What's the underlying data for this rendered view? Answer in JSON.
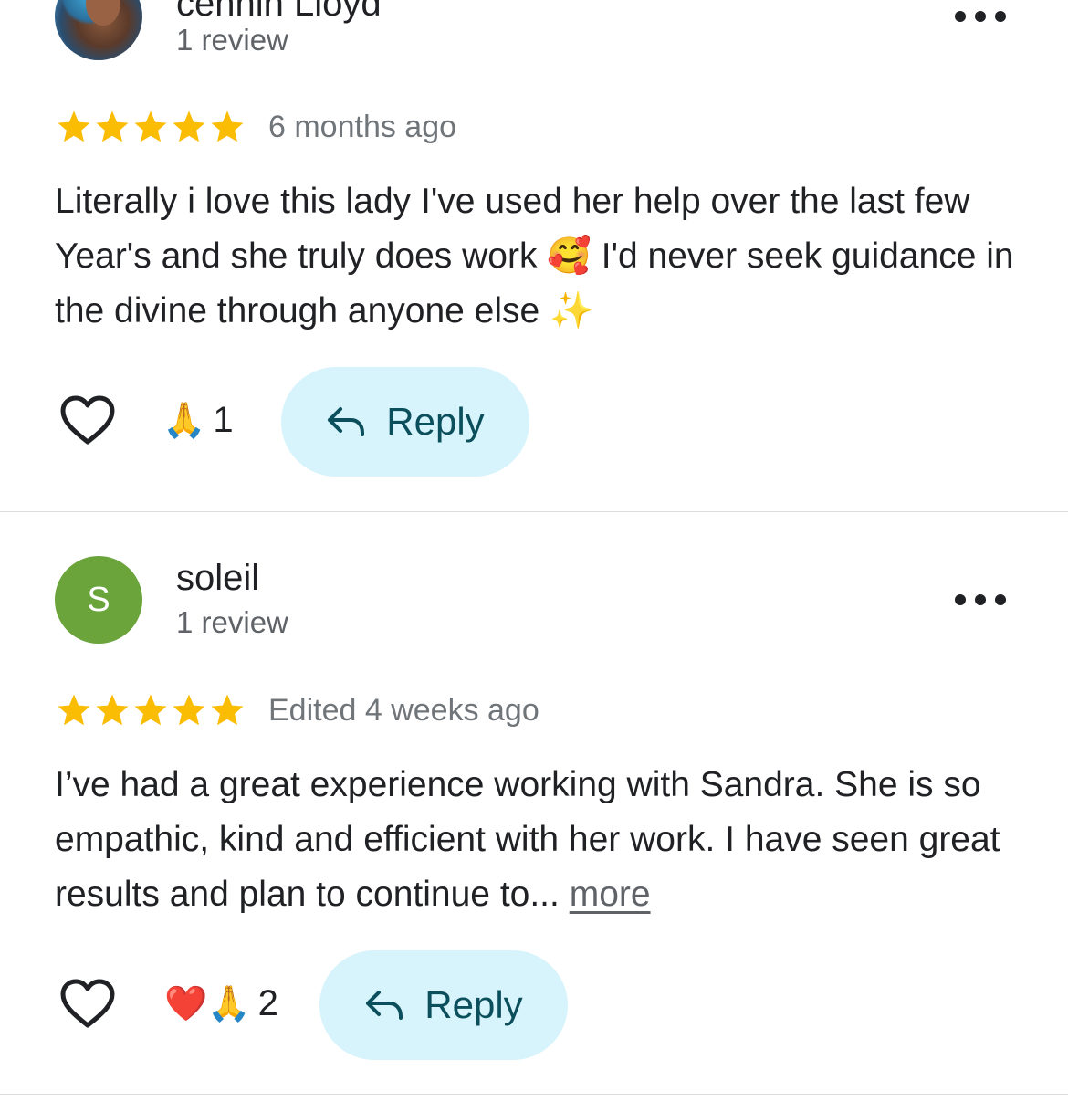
{
  "reviews": [
    {
      "name": "cehhin Lloyd",
      "review_count": "1 review",
      "rating": 5,
      "date": "6 months ago",
      "text": "Literally i love this lady I've used her help over the last few Year's and she truly does work 🥰 I'd never seek guidance in the divine through anyone else ✨",
      "more_label": "",
      "reactions_emoji": "🙏",
      "reactions_count": "1",
      "reply_label": "Reply",
      "avatar_type": "photo"
    },
    {
      "name": "soleil",
      "review_count": "1 review",
      "rating": 5,
      "date": "Edited 4 weeks ago",
      "text": "I’ve had a great experience working with Sandra. She is so empathic, kind and efficient with her work. I have seen great results and plan to continue to...",
      "more_label": "more",
      "reactions_emoji": "❤️🙏",
      "reactions_count": "2",
      "reply_label": "Reply",
      "avatar_letter": "S",
      "avatar_color": "#6aa43a",
      "avatar_type": "letter"
    }
  ],
  "colors": {
    "star": "#fbbc04",
    "reply_bg": "#d7f3fb",
    "reply_text": "#0b4f5c",
    "divider": "#dadce0"
  },
  "icons": {
    "like": "heart-outline-icon",
    "reply": "reply-arrow-icon",
    "overflow": "more-horizontal-icon",
    "star": "star-filled-icon"
  }
}
